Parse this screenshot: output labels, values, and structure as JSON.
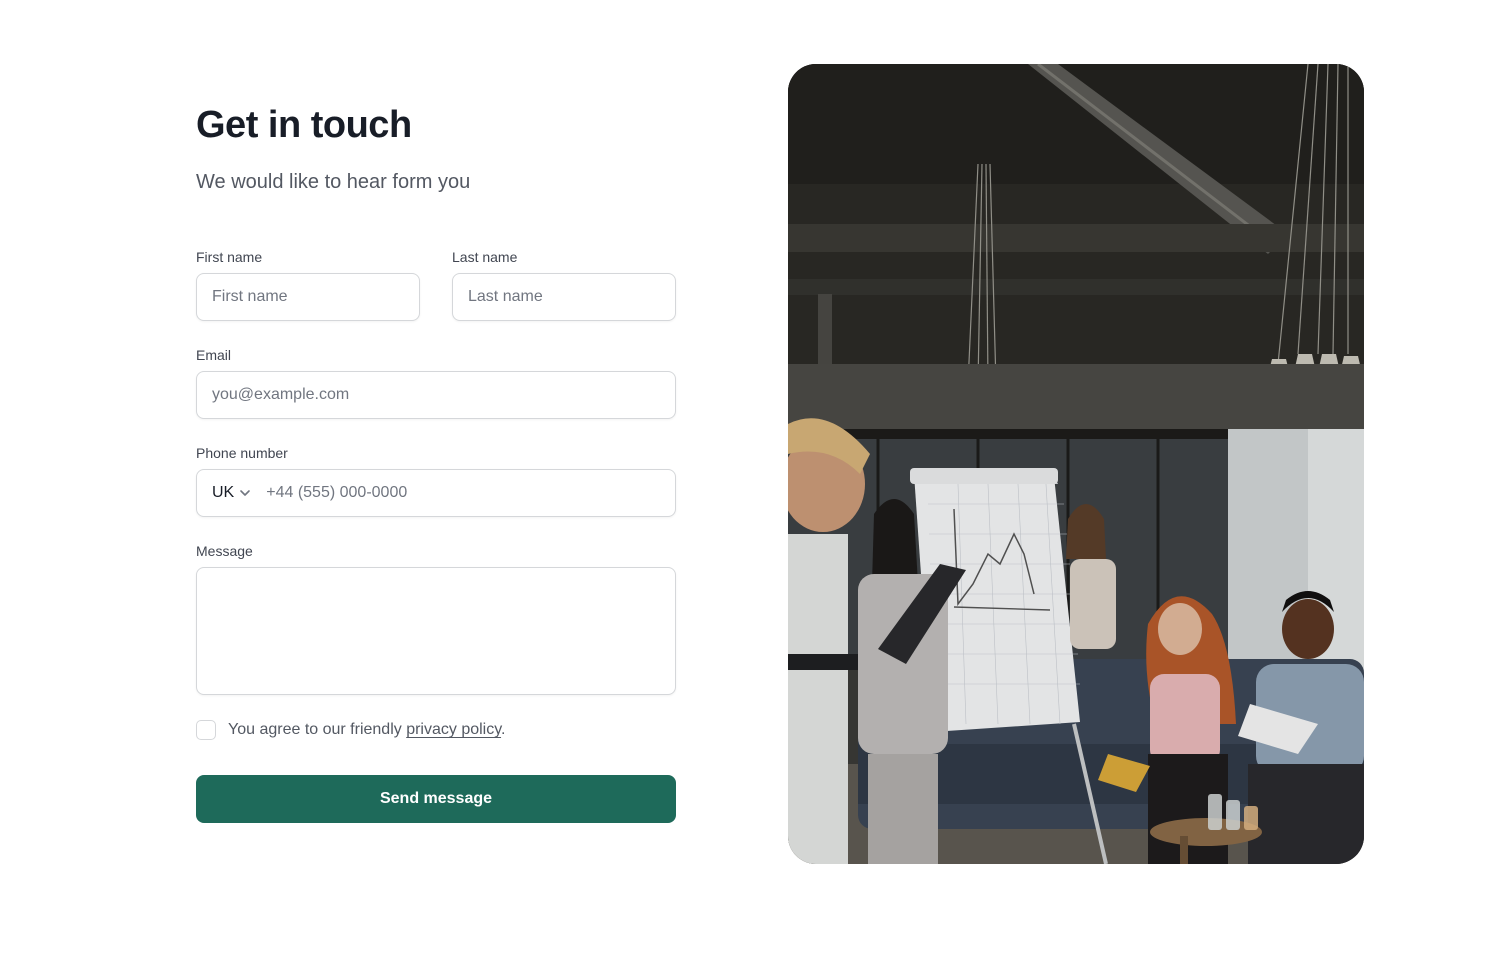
{
  "header": {
    "title": "Get in touch",
    "subtitle": "We would like to hear form you"
  },
  "form": {
    "first_name": {
      "label": "First name",
      "placeholder": "First name"
    },
    "last_name": {
      "label": "Last name",
      "placeholder": "Last name"
    },
    "email": {
      "label": "Email",
      "placeholder": "you@example.com"
    },
    "phone": {
      "label": "Phone number",
      "country": "UK",
      "placeholder": "+44 (555) 000-0000"
    },
    "message": {
      "label": "Message"
    },
    "agree": {
      "prefix": "You agree to our friendly ",
      "link": "privacy policy",
      "suffix": "."
    },
    "submit_label": "Send message"
  },
  "colors": {
    "accent": "#1e6a5a",
    "border": "#d5d7da",
    "title": "#181d27",
    "muted": "#535862"
  },
  "icons": {
    "country_dropdown": "chevron-down-icon"
  }
}
